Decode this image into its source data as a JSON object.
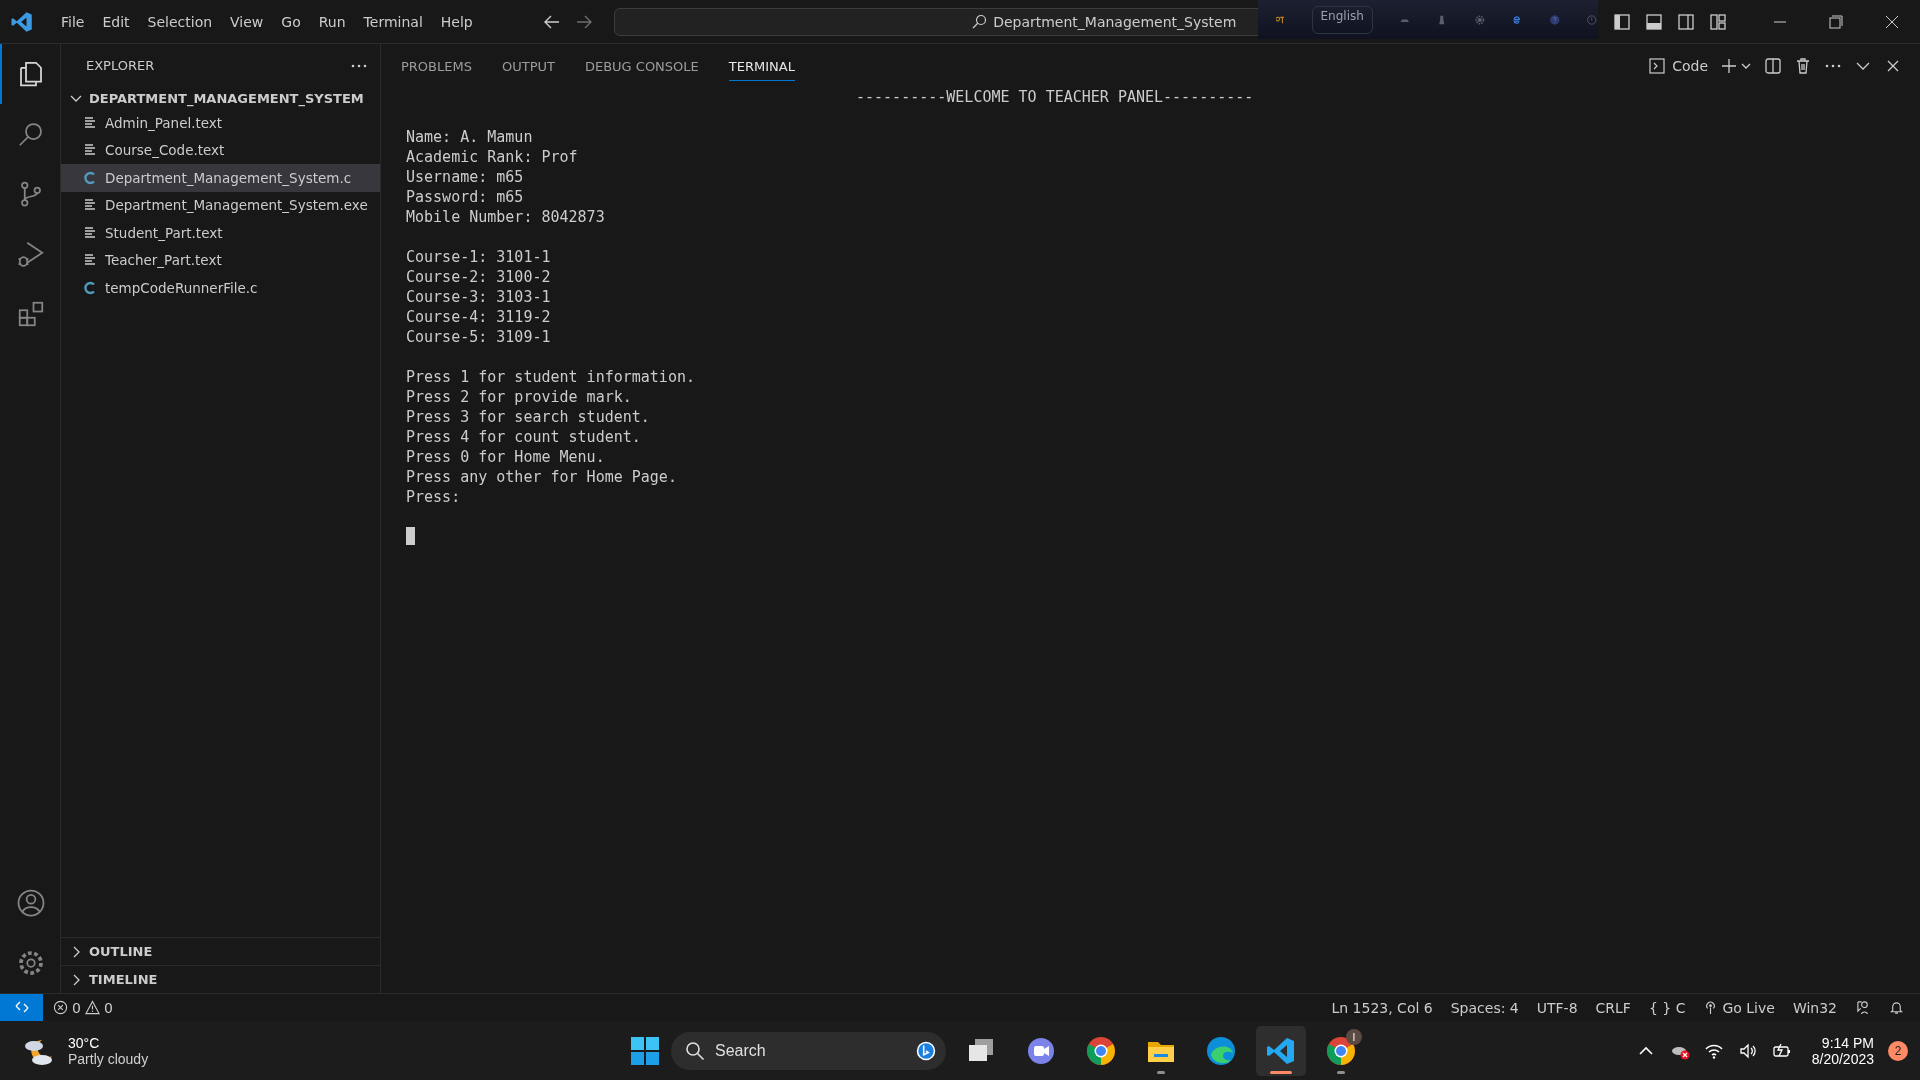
{
  "title_bar": {
    "menu": [
      {
        "label": "File"
      },
      {
        "label": "Edit"
      },
      {
        "label": "Selection"
      },
      {
        "label": "View"
      },
      {
        "label": "Go"
      },
      {
        "label": "Run"
      },
      {
        "label": "Terminal"
      },
      {
        "label": "Help"
      }
    ],
    "command_center": "Department_Management_System",
    "language_bar": {
      "language": "English"
    }
  },
  "activity_bar": [
    {
      "kind": "explorer",
      "selected": true
    },
    {
      "kind": "search",
      "selected": false
    },
    {
      "kind": "source-control",
      "selected": false
    },
    {
      "kind": "run-debug",
      "selected": false
    },
    {
      "kind": "extensions",
      "selected": false
    }
  ],
  "sidebar": {
    "title": "EXPLORER",
    "folder": {
      "name": "DEPARTMENT_MANAGEMENT_SYSTEM",
      "expanded": true,
      "files": [
        {
          "name": "Admin_Panel.text",
          "kind": "text",
          "selected": false
        },
        {
          "name": "Course_Code.text",
          "kind": "text",
          "selected": false
        },
        {
          "name": "Department_Management_System.c",
          "kind": "c",
          "selected": true
        },
        {
          "name": "Department_Management_System.exe",
          "kind": "text",
          "selected": false
        },
        {
          "name": "Student_Part.text",
          "kind": "text",
          "selected": false
        },
        {
          "name": "Teacher_Part.text",
          "kind": "text",
          "selected": false
        },
        {
          "name": "tempCodeRunnerFile.c",
          "kind": "c",
          "selected": false
        }
      ]
    },
    "sections": [
      {
        "label": "OUTLINE",
        "expanded": false
      },
      {
        "label": "TIMELINE",
        "expanded": false
      }
    ]
  },
  "panel": {
    "tabs": [
      {
        "label": "PROBLEMS",
        "selected": false
      },
      {
        "label": "OUTPUT",
        "selected": false
      },
      {
        "label": "DEBUG CONSOLE",
        "selected": false
      },
      {
        "label": "TERMINAL",
        "selected": true
      }
    ],
    "terminal_name": "Code",
    "terminal": {
      "heading": "----------WELCOME TO TEACHER PANEL----------",
      "blocks": [
        [
          "Name: A. Mamun",
          "Academic Rank: Prof",
          "Username: m65",
          "Password: m65",
          "Mobile Number: 8042873"
        ],
        [
          "Course-1: 3101-1",
          "Course-2: 3100-2",
          "Course-3: 3103-1",
          "Course-4: 3119-2",
          "Course-5: 3109-1"
        ],
        [
          "Press 1 for student information.",
          "Press 2 for provide mark.",
          "Press 3 for search student.",
          "Press 4 for count student.",
          "Press 0 for Home Menu.",
          "Press any other for Home Page.",
          "Press:"
        ]
      ]
    }
  },
  "status_bar": {
    "errors": "0",
    "warnings": "0",
    "items": [
      "Ln 1523, Col 6",
      "Spaces: 4",
      "UTF-8",
      "CRLF",
      "{ } C",
      "Go Live",
      "Win32"
    ]
  },
  "taskbar": {
    "weather": {
      "temperature": "30°C",
      "condition": "Partly cloudy"
    },
    "search_placeholder": "Search",
    "apps": [
      {
        "kind": "task-view",
        "running": false,
        "selected": false
      },
      {
        "kind": "meet",
        "running": false,
        "selected": false
      },
      {
        "kind": "chrome",
        "running": false,
        "selected": false
      },
      {
        "kind": "folder",
        "running": true,
        "selected": false
      },
      {
        "kind": "edge",
        "running": false,
        "selected": false
      },
      {
        "kind": "vscode",
        "running": true,
        "selected": true
      },
      {
        "kind": "chrome",
        "running": true,
        "selected": false,
        "badge": "I"
      }
    ],
    "time": "9:14 PM",
    "date": "8/20/2023",
    "notifications": "2"
  }
}
